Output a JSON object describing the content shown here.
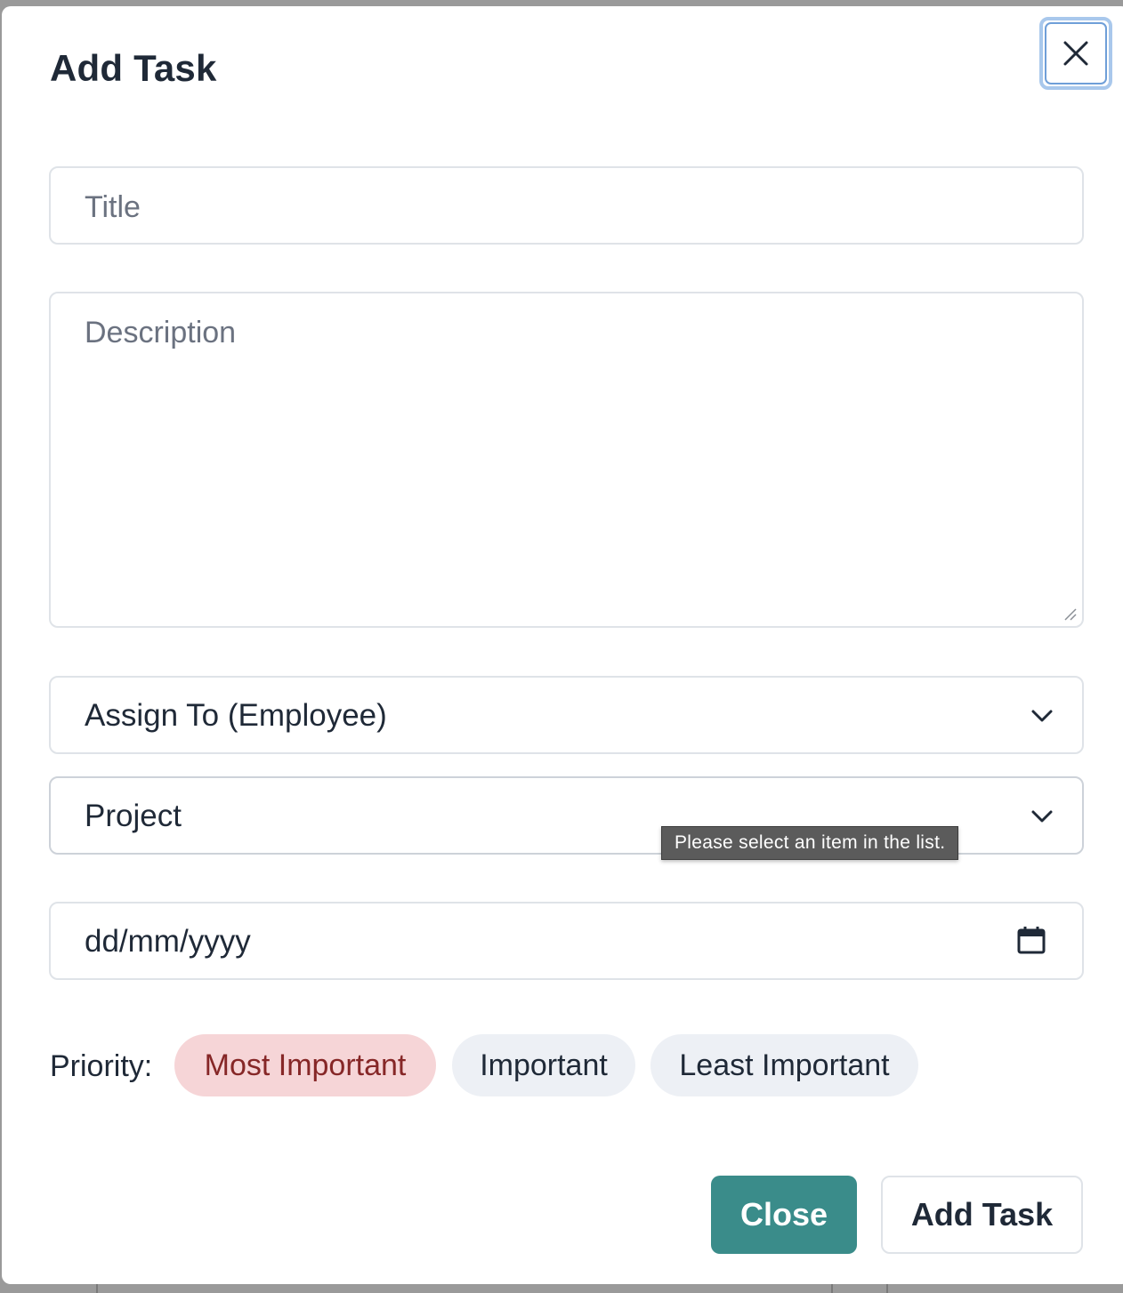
{
  "modal": {
    "title": "Add Task",
    "close_icon": "close-icon"
  },
  "form": {
    "title_placeholder": "Title",
    "description_placeholder": "Description",
    "assign_to_selected": "Assign To (Employee)",
    "project_selected": "Project",
    "date_value": "dd/mm/yyyy",
    "validation_tooltip": "Please select an item in the list."
  },
  "priority": {
    "label": "Priority:",
    "options": [
      "Most Important",
      "Important",
      "Least Important"
    ],
    "selected": "Most Important"
  },
  "footer": {
    "close_label": "Close",
    "add_label": "Add Task"
  },
  "colors": {
    "primary_teal": "#3a8c8a",
    "selected_pill_bg": "#f6d5d7",
    "selected_pill_text": "#862727",
    "pill_bg": "#edf0f5",
    "focus_ring": "#a9c8ec"
  }
}
